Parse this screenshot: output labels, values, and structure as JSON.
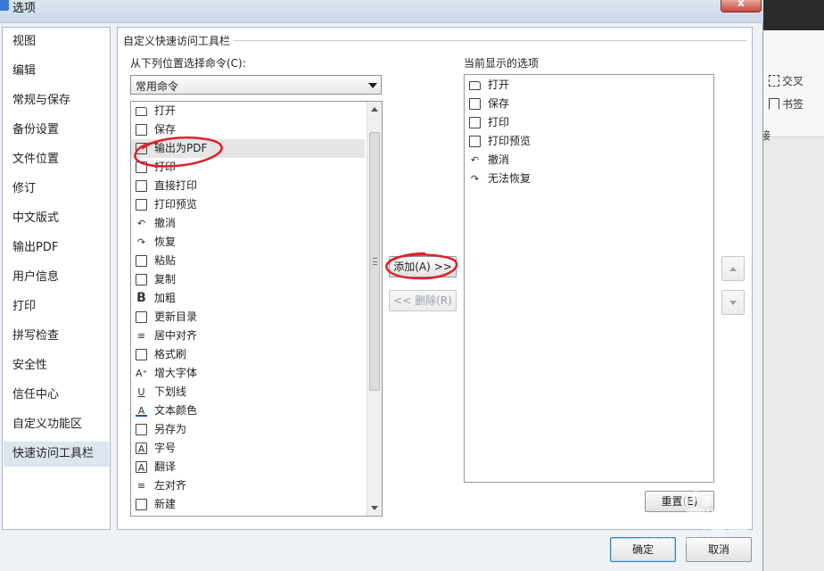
{
  "window": {
    "title": "选项",
    "close_label": "x"
  },
  "background_app": {
    "items": [
      {
        "label": "交叉",
        "icon": "cross-reference-icon"
      },
      {
        "label": "书签",
        "icon": "bookmark-icon"
      }
    ],
    "left_fragment": "接"
  },
  "sidebar": {
    "items": [
      {
        "label": "视图"
      },
      {
        "label": "编辑"
      },
      {
        "label": "常规与保存"
      },
      {
        "label": "备份设置"
      },
      {
        "label": "文件位置"
      },
      {
        "label": "修订"
      },
      {
        "label": "中文版式"
      },
      {
        "label": "输出PDF"
      },
      {
        "label": "用户信息"
      },
      {
        "label": "打印"
      },
      {
        "label": "拼写检查"
      },
      {
        "label": "安全性"
      },
      {
        "label": "信任中心"
      },
      {
        "label": "自定义功能区"
      },
      {
        "label": "快速访问工具栏"
      }
    ],
    "active": "快速访问工具栏"
  },
  "main": {
    "group_title": "自定义快速访问工具栏",
    "choose_label": "从下列位置选择命令(C):",
    "combo_value": "常用命令",
    "current_label": "当前显示的选项",
    "commands": [
      {
        "label": "打开",
        "icon": "folder-open-icon"
      },
      {
        "label": "保存",
        "icon": "save-icon"
      },
      {
        "label": "输出为PDF",
        "icon": "pdf-export-icon"
      },
      {
        "label": "打印",
        "icon": "printer-icon"
      },
      {
        "label": "直接打印",
        "icon": "direct-print-icon"
      },
      {
        "label": "打印预览",
        "icon": "print-preview-icon"
      },
      {
        "label": "撤消",
        "icon": "undo-icon"
      },
      {
        "label": "恢复",
        "icon": "redo-icon"
      },
      {
        "label": "粘贴",
        "icon": "paste-icon"
      },
      {
        "label": "复制",
        "icon": "copy-icon"
      },
      {
        "label": "加粗",
        "icon": "bold-icon"
      },
      {
        "label": "更新目录",
        "icon": "update-toc-icon"
      },
      {
        "label": "居中对齐",
        "icon": "align-center-icon"
      },
      {
        "label": "格式刷",
        "icon": "format-painter-icon"
      },
      {
        "label": "增大字体",
        "icon": "grow-font-icon"
      },
      {
        "label": "下划线",
        "icon": "underline-icon"
      },
      {
        "label": "文本颜色",
        "icon": "font-color-icon"
      },
      {
        "label": "另存为",
        "icon": "save-as-icon"
      },
      {
        "label": "字号",
        "icon": "font-size-icon"
      },
      {
        "label": "翻译",
        "icon": "translate-icon"
      },
      {
        "label": "左对齐",
        "icon": "align-left-icon"
      },
      {
        "label": "新建",
        "icon": "new-document-icon"
      }
    ],
    "current": [
      {
        "label": "打开",
        "icon": "folder-open-icon"
      },
      {
        "label": "保存",
        "icon": "save-icon"
      },
      {
        "label": "打印",
        "icon": "printer-icon"
      },
      {
        "label": "打印预览",
        "icon": "print-preview-icon"
      },
      {
        "label": "撤消",
        "icon": "undo-icon"
      },
      {
        "label": "无法恢复",
        "icon": "redo-icon"
      }
    ],
    "add_button": "添加(A) >>",
    "remove_button": "<< 删除(R)",
    "reset_button": "重置(E)"
  },
  "footer": {
    "ok": "确定",
    "cancel": "取消"
  },
  "watermark": {
    "text": "Baidu 经验",
    "subtext": "jingyan.baidu.com"
  },
  "colors": {
    "annotation": "#e0202a",
    "selection": "#e6e6e6",
    "titlebar": "#c9d8e7"
  }
}
